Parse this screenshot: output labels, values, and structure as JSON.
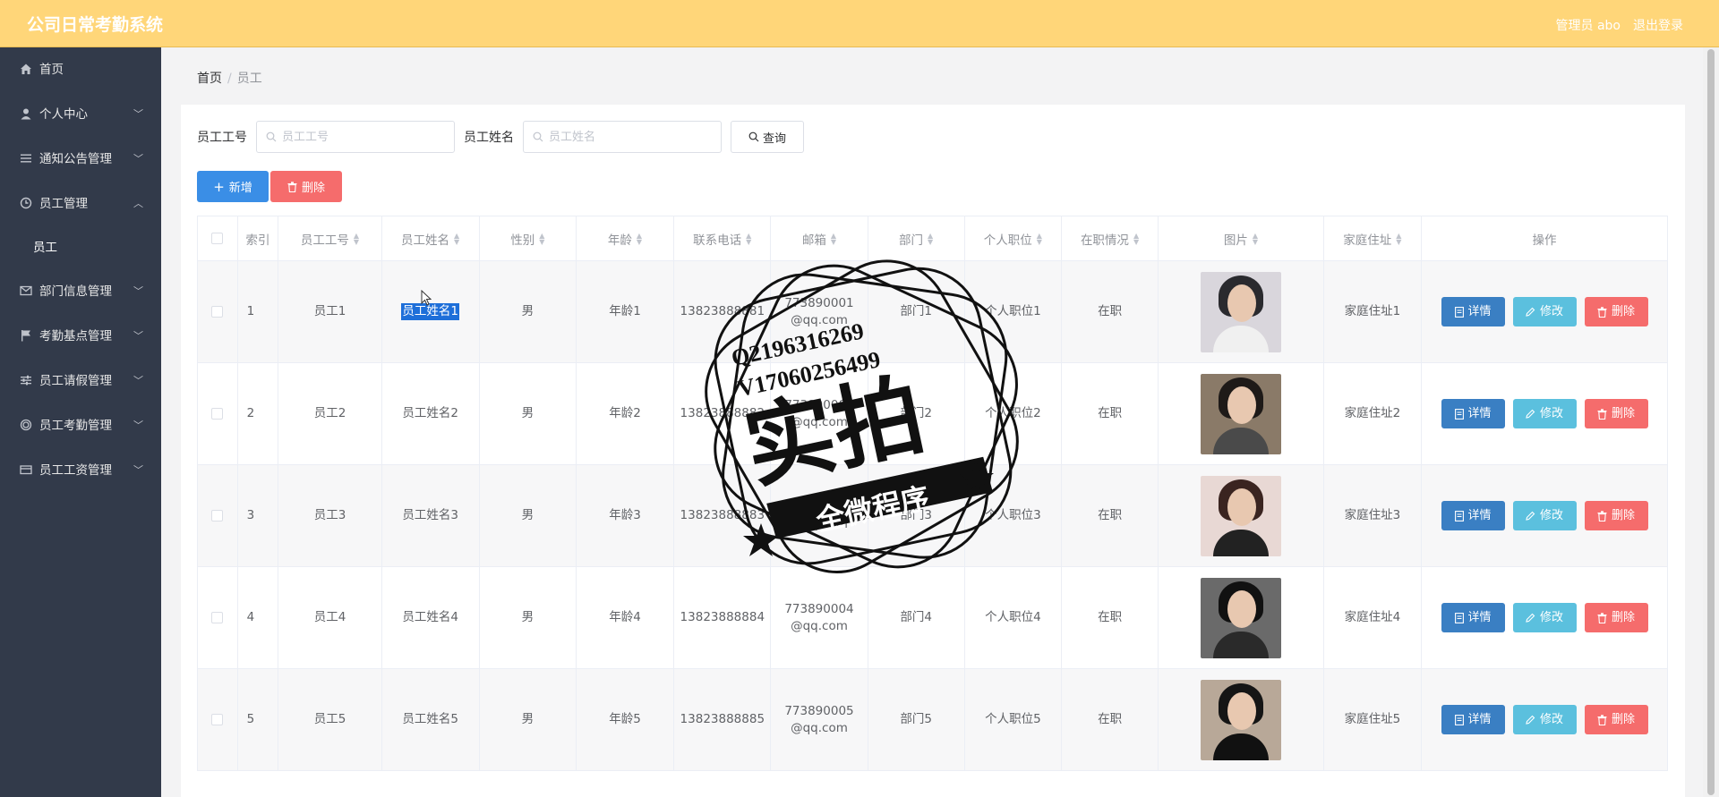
{
  "app": {
    "title": "公司日常考勤系统",
    "user": "管理员 abo",
    "logout": "退出登录"
  },
  "sidebar": {
    "items": [
      {
        "label": "首页",
        "icon": "home-icon",
        "chev": ""
      },
      {
        "label": "个人中心",
        "icon": "user-icon",
        "chev": "﹀"
      },
      {
        "label": "通知公告管理",
        "icon": "list-icon",
        "chev": "﹀"
      },
      {
        "label": "员工管理",
        "icon": "clock-icon",
        "chev": "︿"
      },
      {
        "label": "员工",
        "icon": "",
        "chev": ""
      },
      {
        "label": "部门信息管理",
        "icon": "mail-icon",
        "chev": "﹀"
      },
      {
        "label": "考勤基点管理",
        "icon": "flag-icon",
        "chev": "﹀"
      },
      {
        "label": "员工请假管理",
        "icon": "sliders-icon",
        "chev": "﹀"
      },
      {
        "label": "员工考勤管理",
        "icon": "circle-icon",
        "chev": "﹀"
      },
      {
        "label": "员工工资管理",
        "icon": "card-icon",
        "chev": "﹀"
      }
    ]
  },
  "breadcrumb": {
    "home": "首页",
    "sep": "/",
    "current": "员工"
  },
  "search": {
    "id_label": "员工工号",
    "id_placeholder": "员工工号",
    "name_label": "员工姓名",
    "name_placeholder": "员工姓名",
    "query": "查询"
  },
  "actions": {
    "add": "新增",
    "delete": "删除"
  },
  "table": {
    "headers": [
      "索引",
      "员工工号",
      "员工姓名",
      "性别",
      "年龄",
      "联系电话",
      "邮箱",
      "部门",
      "个人职位",
      "在职情况",
      "图片",
      "家庭住址",
      "操作"
    ],
    "rows": [
      {
        "idx": "1",
        "id": "员工1",
        "name": "员工姓名1",
        "gender": "男",
        "age": "年龄1",
        "phone": "13823888881",
        "email": "773890001@qq.com",
        "dept": "部门1",
        "position": "个人职位1",
        "status": "在职",
        "address": "家庭住址1"
      },
      {
        "idx": "2",
        "id": "员工2",
        "name": "员工姓名2",
        "gender": "男",
        "age": "年龄2",
        "phone": "13823888882",
        "email": "773890002@qq.com",
        "dept": "部门2",
        "position": "个人职位2",
        "status": "在职",
        "address": "家庭住址2"
      },
      {
        "idx": "3",
        "id": "员工3",
        "name": "员工姓名3",
        "gender": "男",
        "age": "年龄3",
        "phone": "13823888883",
        "email": "773890003@qq.com",
        "dept": "部门3",
        "position": "个人职位3",
        "status": "在职",
        "address": "家庭住址3"
      },
      {
        "idx": "4",
        "id": "员工4",
        "name": "员工姓名4",
        "gender": "男",
        "age": "年龄4",
        "phone": "13823888884",
        "email": "773890004@qq.com",
        "dept": "部门4",
        "position": "个人职位4",
        "status": "在职",
        "address": "家庭住址4"
      },
      {
        "idx": "5",
        "id": "员工5",
        "name": "员工姓名5",
        "gender": "男",
        "age": "年龄5",
        "phone": "13823888885",
        "email": "773890005@qq.com",
        "dept": "部门5",
        "position": "个人职位5",
        "status": "在职",
        "address": "家庭住址5"
      }
    ],
    "ops": {
      "detail": "详情",
      "edit": "修改",
      "delete": "删除"
    }
  },
  "watermark": {
    "qq": "Q2196316269",
    "v": "V17060256499",
    "main": "实拍",
    "sub": "全微程序"
  },
  "colors": {
    "topbar": "#ffd679",
    "sidebar": "#323a4a",
    "primary": "#3a8ee6",
    "danger": "#f56c6c",
    "info": "#5bc0de"
  }
}
